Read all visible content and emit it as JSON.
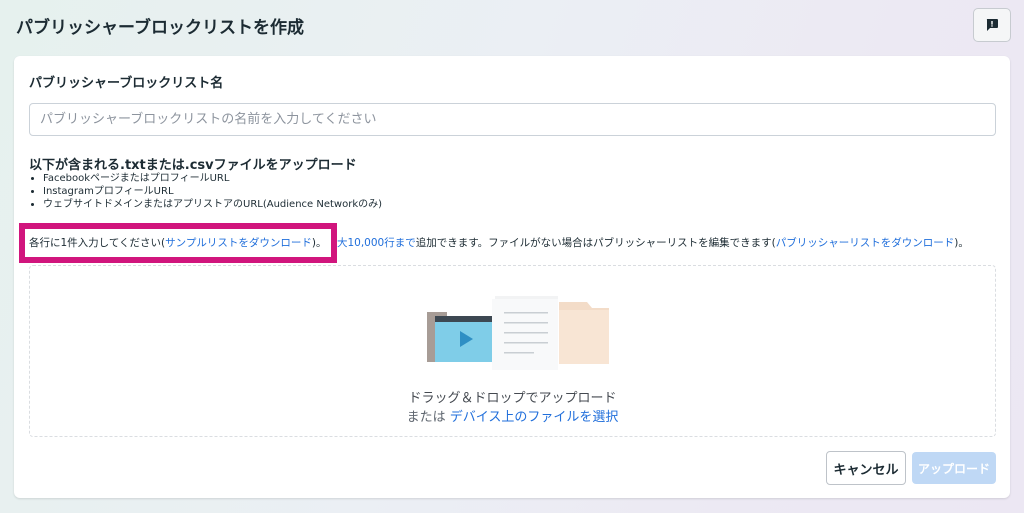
{
  "header": {
    "title": "パブリッシャーブロックリストを作成",
    "feedback_icon": "feedback-exclamation-icon"
  },
  "form": {
    "name_label": "パブリッシャーブロックリスト名",
    "name_placeholder": "パブリッシャーブロックリストの名前を入力してください",
    "name_value": "",
    "upload_label": "以下が含まれる.txtまたは.csvファイルをアップロード",
    "bullets": [
      "FacebookページまたはプロフィールURL",
      "InstagramプロフィールURL",
      "ウェブサイトドメインまたはアプリストアのURL(Audience Networkのみ)"
    ],
    "note": {
      "prefix": "各行に1件入力してください(",
      "sample_link": "サンプルリストをダウンロード",
      "after_sample": ")。",
      "max_link": "最大10,000行まで",
      "middle": "追加できます。ファイルがない場合はパブリッシャーリストを編集できます(",
      "publisher_link": "パブリッシャーリストをダウンロード",
      "suffix": ")。"
    }
  },
  "dropzone": {
    "main_text": "ドラッグ＆ドロップでアップロード",
    "or_text": "または",
    "select_link": "デバイス上のファイルを選択"
  },
  "buttons": {
    "cancel": "キャンセル",
    "upload": "アップロード"
  },
  "colors": {
    "highlight_border": "#d1157d",
    "link": "#216fdb",
    "upload_disabled": "#bfd8f5"
  }
}
